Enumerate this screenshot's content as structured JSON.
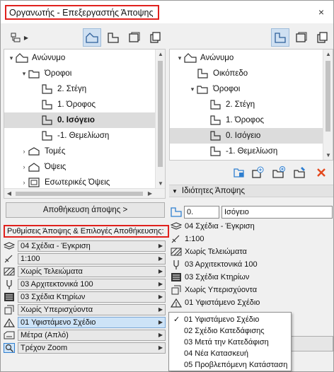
{
  "window": {
    "title": "Οργανωτής - Επεξεργαστής Άποψης",
    "close": "×"
  },
  "left": {
    "tree": [
      {
        "label": "Ανώνυμο",
        "exp": "▾",
        "indent": 0,
        "icon": "building-icon"
      },
      {
        "label": "Όροφοι",
        "exp": "▾",
        "indent": 1,
        "icon": "folder-icon"
      },
      {
        "label": "2. Στέγη",
        "exp": "",
        "indent": 2,
        "icon": "story-icon"
      },
      {
        "label": "1. Όροφος",
        "exp": "",
        "indent": 2,
        "icon": "story-icon"
      },
      {
        "label": "0. Ισόγειο",
        "exp": "",
        "indent": 2,
        "icon": "story-icon",
        "selected": true,
        "bold": true
      },
      {
        "label": "-1. Θεμελίωση",
        "exp": "",
        "indent": 2,
        "icon": "story-icon"
      },
      {
        "label": "Τομές",
        "exp": "›",
        "indent": 1,
        "icon": "section-icon"
      },
      {
        "label": "Όψεις",
        "exp": "›",
        "indent": 1,
        "icon": "elevation-icon"
      },
      {
        "label": "Εσωτερικές Όψεις",
        "exp": "›",
        "indent": 1,
        "icon": "interior-elevation-icon"
      }
    ],
    "save_button": "Αποθήκευση άποψης >",
    "settings_label": "Ρυθμίσεις Άποψης & Επιλογές Αποθήκευσης:",
    "settings": [
      {
        "label": "04 Σχέδια - Έγκριση",
        "icon": "layers-icon"
      },
      {
        "label": "1:100",
        "icon": "scale-icon"
      },
      {
        "label": "Χωρίς Τελειώματα",
        "icon": "hatch-icon"
      },
      {
        "label": "03 Αρχιτεκτονικά 100",
        "icon": "pen-icon"
      },
      {
        "label": "03 Σχέδια Κτηρίων",
        "icon": "mvo-icon"
      },
      {
        "label": "Χωρίς Υπερισχύοντα",
        "icon": "override-icon"
      },
      {
        "label": "01 Υφιστάμενο Σχέδιο",
        "icon": "renovation-icon",
        "highlight": true
      },
      {
        "label": "Μέτρα (Απλό)",
        "icon": "dimension-icon"
      },
      {
        "label": "Τρέχον Zoom",
        "icon": "zoom-icon"
      }
    ]
  },
  "right": {
    "tree": [
      {
        "label": "Ανώνυμο",
        "exp": "▾",
        "indent": 0,
        "icon": "building-icon"
      },
      {
        "label": "Οικόπεδο",
        "exp": "",
        "indent": 1,
        "icon": "story-icon"
      },
      {
        "label": "Όροφοι",
        "exp": "▾",
        "indent": 1,
        "icon": "folder-icon"
      },
      {
        "label": "2. Στέγη",
        "exp": "",
        "indent": 2,
        "icon": "story-icon"
      },
      {
        "label": "1. Όροφος",
        "exp": "",
        "indent": 2,
        "icon": "story-icon"
      },
      {
        "label": "0. Ισόγειο",
        "exp": "",
        "indent": 2,
        "icon": "story-icon",
        "selected": true
      },
      {
        "label": "-1. Θεμελίωση",
        "exp": "",
        "indent": 2,
        "icon": "story-icon"
      }
    ],
    "section_title": "Ιδιότητες Άποψης",
    "id_value": "0.",
    "name_value": "Ισόγειο",
    "props": [
      {
        "label": "04 Σχέδια - Έγκριση",
        "icon": "layers-icon"
      },
      {
        "label": "1:100",
        "icon": "scale-icon"
      },
      {
        "label": "Χωρίς Τελειώματα",
        "icon": "hatch-icon"
      },
      {
        "label": "03 Αρχιτεκτονικά 100",
        "icon": "pen-icon"
      },
      {
        "label": "03 Σχέδια Κτηρίων",
        "icon": "mvo-icon"
      },
      {
        "label": "Χωρίς Υπερισχύοντα",
        "icon": "override-icon"
      },
      {
        "label": "01 Υφιστάμενο Σχέδιο",
        "icon": "renovation-icon"
      }
    ]
  },
  "popup": {
    "items": [
      {
        "label": "01 Υφιστάμενο Σχέδιο",
        "checked": true
      },
      {
        "label": "02 Σχέδιο Κατεδάφισης",
        "checked": false
      },
      {
        "label": "03 Μετά την Κατεδάφιση",
        "checked": false
      },
      {
        "label": "04 Νέα Κατασκευή",
        "checked": false
      },
      {
        "label": "05 Προβλεπόμενη Κατάσταση",
        "checked": false
      }
    ],
    "check_mark": "✓"
  },
  "colors": {
    "accent_blue": "#2f7fd0",
    "highlight_red": "#e0211d",
    "delete_red": "#e4481c"
  }
}
